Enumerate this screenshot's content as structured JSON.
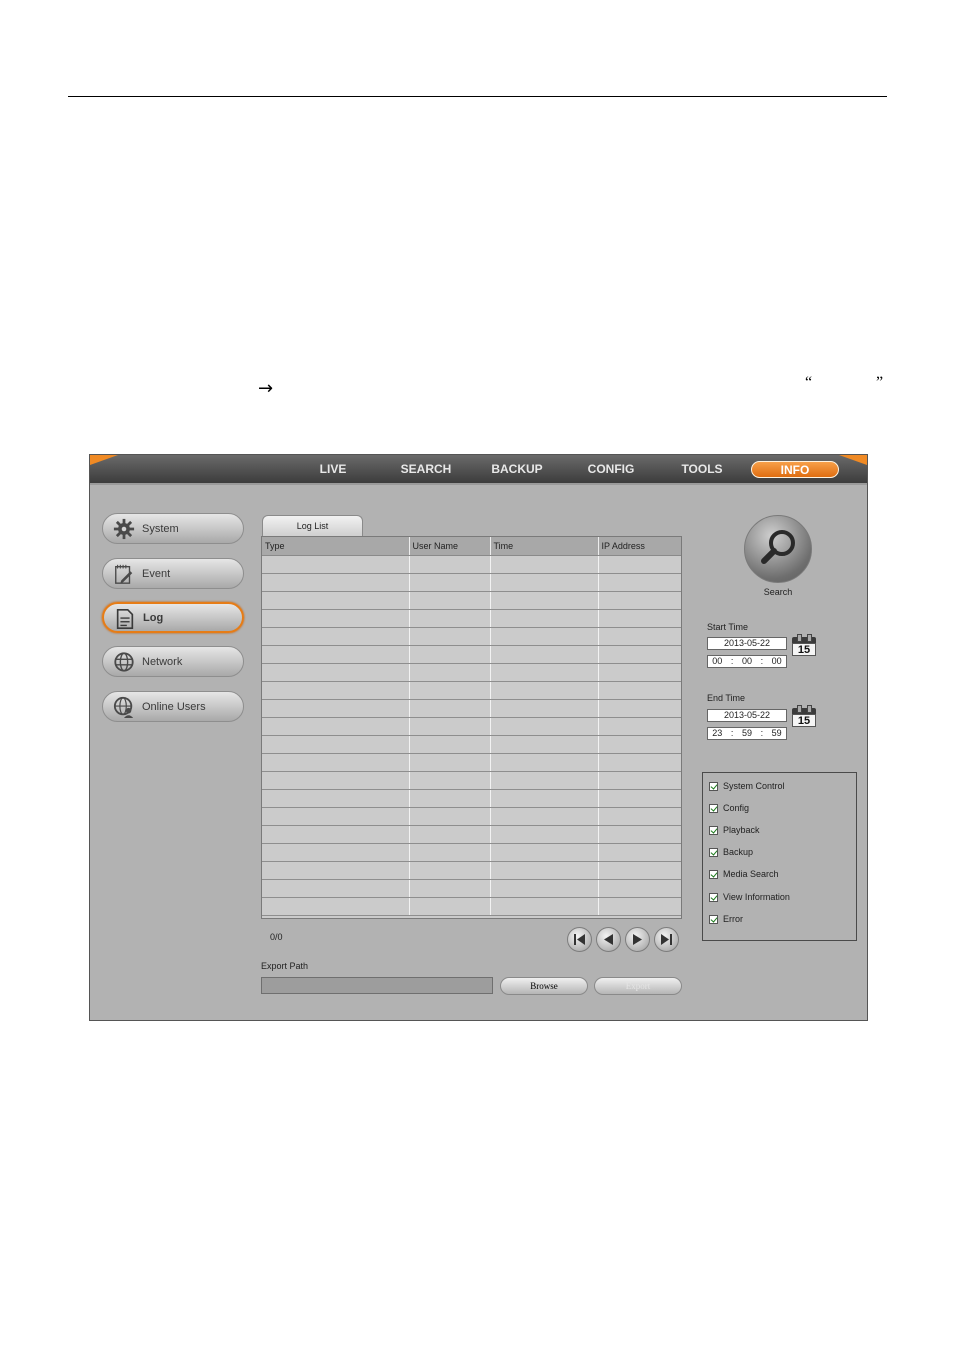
{
  "document": {
    "arrow": "→",
    "open_quote": "“",
    "close_quote": "”"
  },
  "app": {
    "nav": [
      {
        "label": "LIVE"
      },
      {
        "label": "SEARCH"
      },
      {
        "label": "BACKUP"
      },
      {
        "label": "CONFIG"
      },
      {
        "label": "TOOLS"
      },
      {
        "label": "INFO",
        "active": true
      }
    ],
    "sidebar": [
      {
        "label": "System",
        "icon": "gear-icon"
      },
      {
        "label": "Event",
        "icon": "event-note-icon"
      },
      {
        "label": "Log",
        "icon": "document-icon",
        "active": true
      },
      {
        "label": "Network",
        "icon": "globe-icon"
      },
      {
        "label": "Online Users",
        "icon": "globe-user-icon"
      }
    ],
    "log_tab": "Log List",
    "table": {
      "columns": [
        "Type",
        "User Name",
        "Time",
        "IP Address"
      ],
      "empty_rows": 20
    },
    "pagination": {
      "count": "0/0"
    },
    "export": {
      "label": "Export Path",
      "path_value": "",
      "browse_label": "Browse",
      "export_label": "Export"
    },
    "search": {
      "label": "Search"
    },
    "start_time": {
      "label": "Start Time",
      "date": "2013-05-22",
      "hh": "00",
      "mm": "00",
      "ss": "00",
      "calendar": "15"
    },
    "end_time": {
      "label": "End Time",
      "date": "2013-05-22",
      "hh": "23",
      "mm": "59",
      "ss": "59",
      "calendar": "15"
    },
    "filters": [
      {
        "label": "System Control",
        "checked": true
      },
      {
        "label": "Config",
        "checked": true
      },
      {
        "label": "Playback",
        "checked": true
      },
      {
        "label": "Backup",
        "checked": true
      },
      {
        "label": "Media Search",
        "checked": true
      },
      {
        "label": "View Information",
        "checked": true
      },
      {
        "label": "Error",
        "checked": true
      }
    ],
    "colors": {
      "accent": "#e67c16",
      "panel": "#b2b2b2"
    }
  }
}
